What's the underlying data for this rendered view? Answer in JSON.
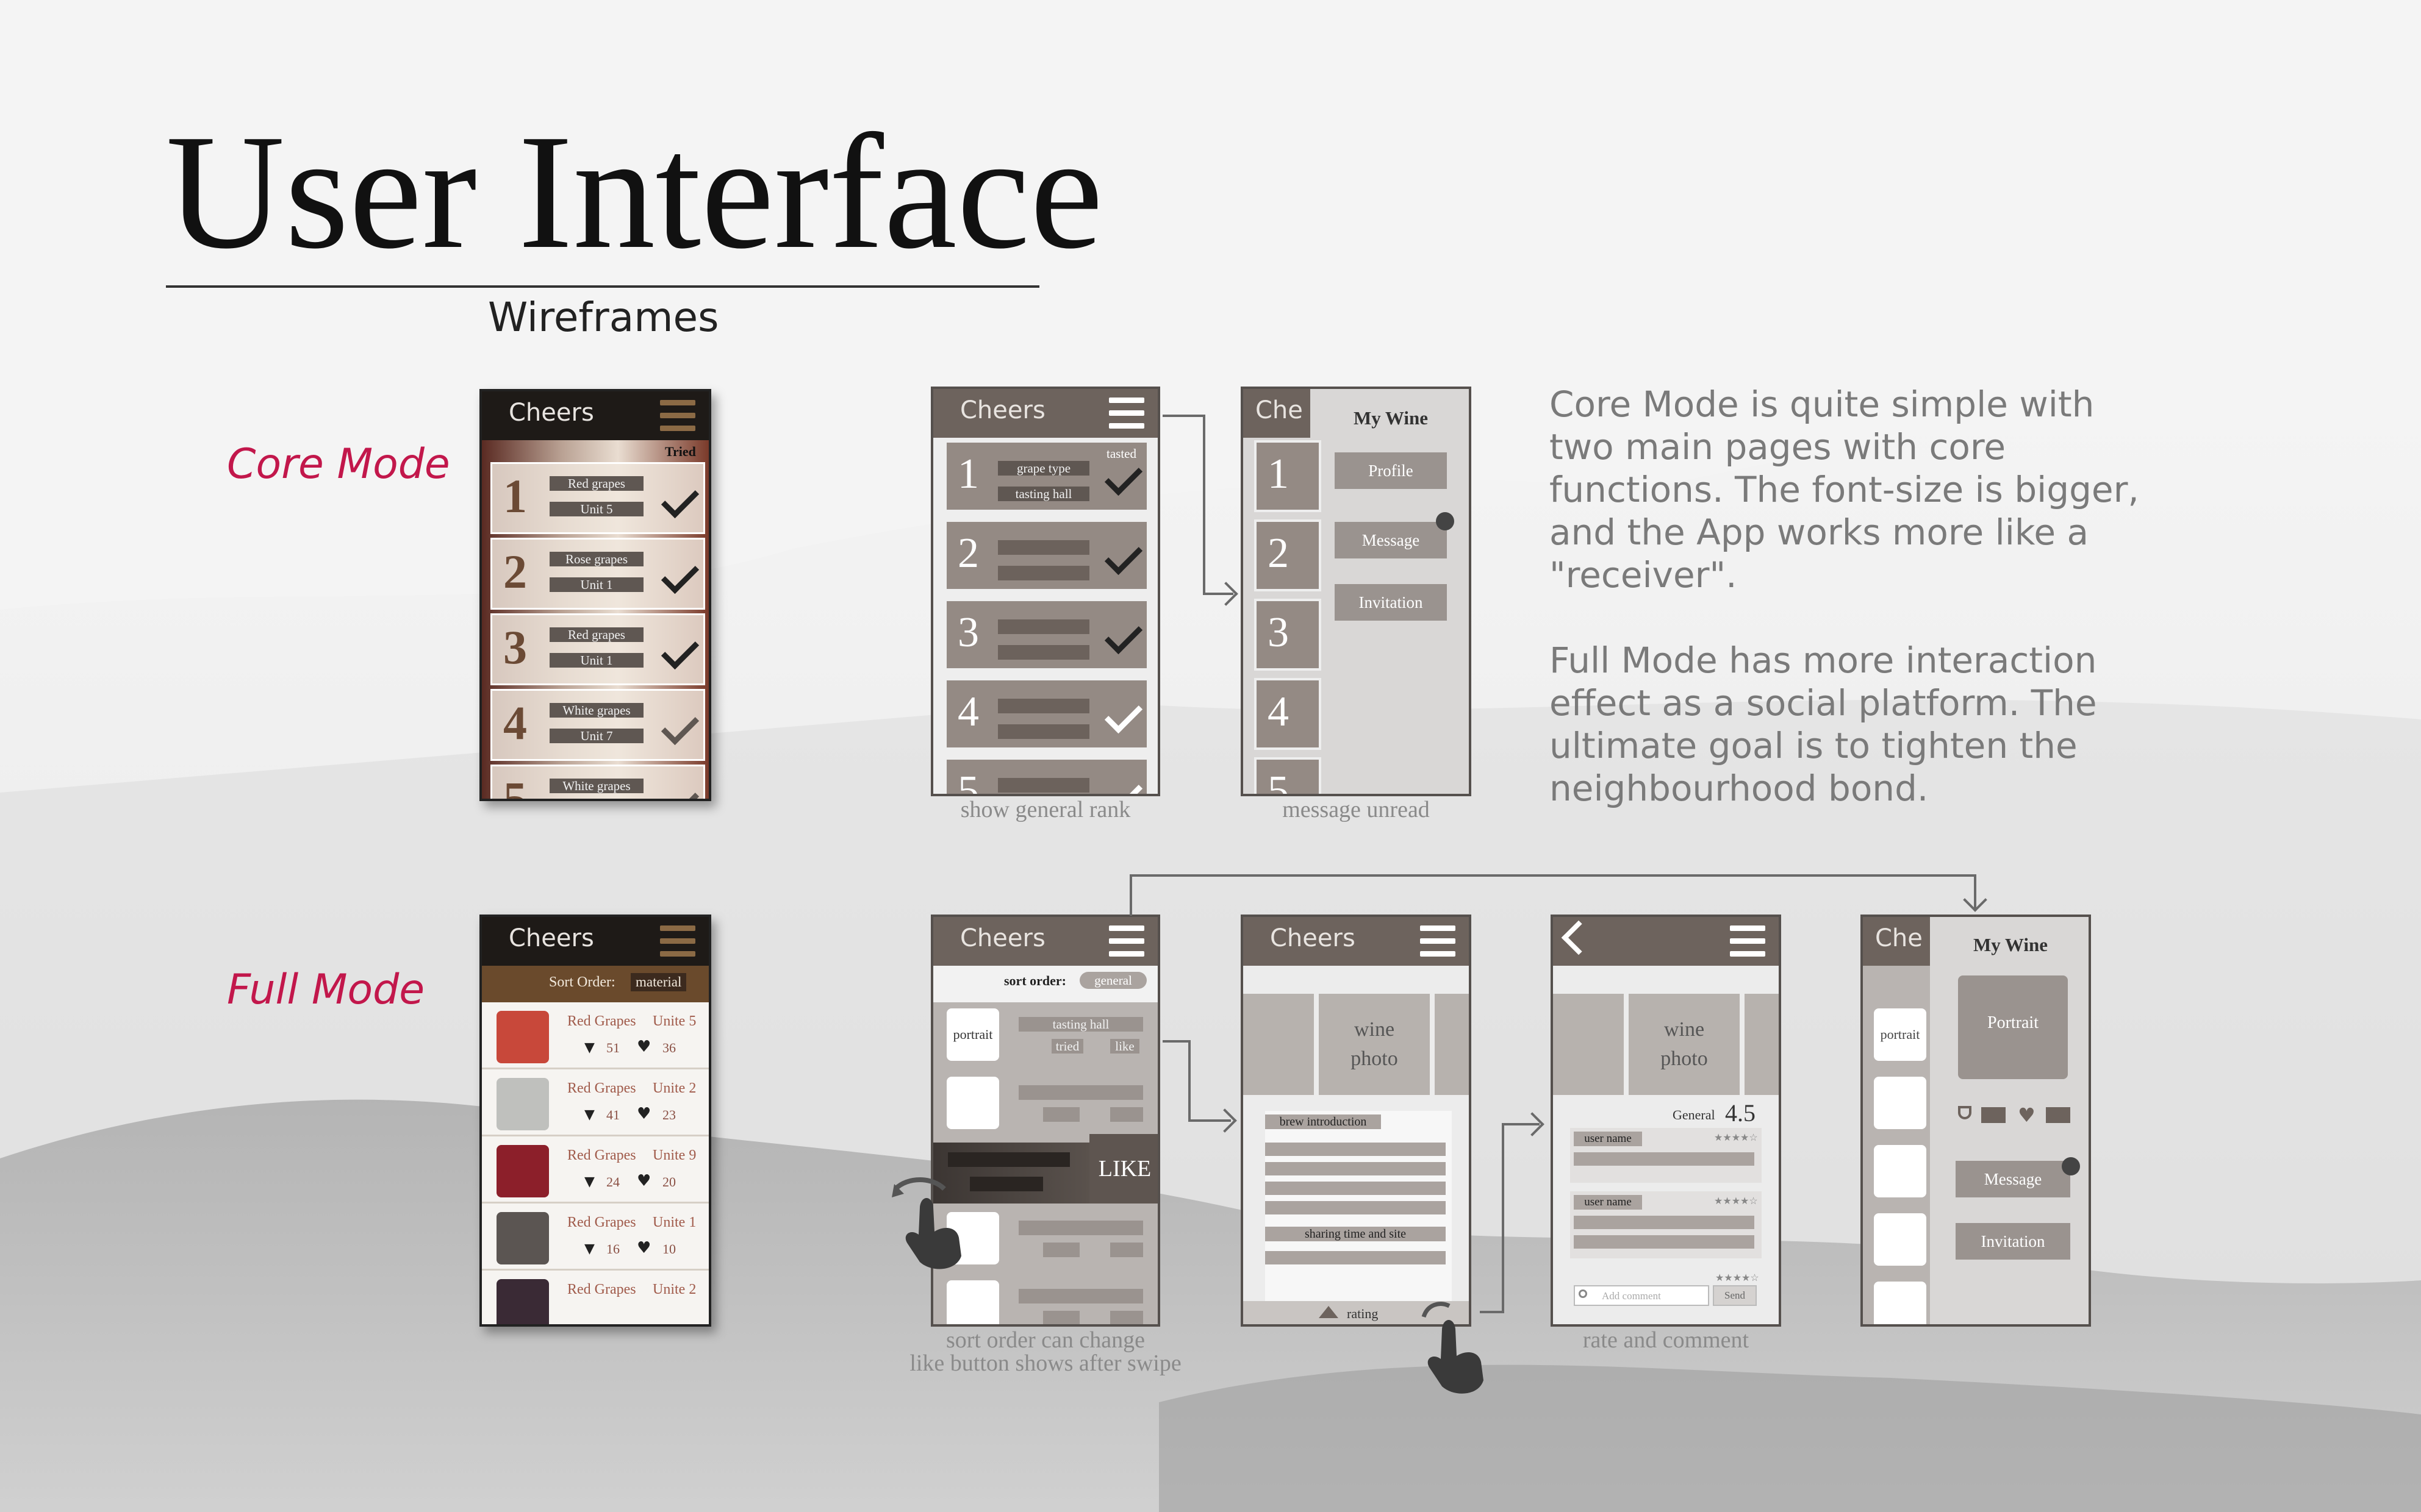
{
  "title": "User Interface",
  "subtitle": "Wireframes",
  "modes": {
    "core": "Core Mode",
    "full": "Full Mode"
  },
  "description": {
    "core_lines": [
      "Core Mode is quite simple with",
      "two main pages with core",
      "functions. The font-size is bigger,",
      "and the App works more like a",
      "\"receiver\"."
    ],
    "full_lines": [
      "Full Mode has more interaction",
      "effect as a social platform. The",
      "ultimate goal is to tighten the",
      "neighbourhood bond."
    ]
  },
  "app_name": "Cheers",
  "app_name_cut": "Che",
  "core_mock": {
    "tried_label": "Tried",
    "rows": [
      {
        "num": "1",
        "grape": "Red grapes",
        "unit": "Unit 5"
      },
      {
        "num": "2",
        "grape": "Rose grapes",
        "unit": "Unit 1"
      },
      {
        "num": "3",
        "grape": "Red grapes",
        "unit": "Unit 1"
      },
      {
        "num": "4",
        "grape": "White grapes",
        "unit": "Unit 7"
      },
      {
        "num": "5",
        "grape": "White grapes",
        "unit": ""
      }
    ]
  },
  "rank_wire": {
    "numbers": [
      "1",
      "2",
      "3",
      "4",
      "5"
    ],
    "grape_type": "grape type",
    "tasting_hall": "tasting hall",
    "tasted": "tasted",
    "caption": "show general rank"
  },
  "menu_wire": {
    "my_wine": "My Wine",
    "profile": "Profile",
    "message": "Message",
    "invitation": "Invitation",
    "caption": "message unread"
  },
  "full_mock": {
    "sort_label": "Sort Order:",
    "sort_value": "material",
    "items": [
      {
        "name": "Red Grapes",
        "unit": "Unite 5",
        "glasses": "51",
        "likes": "36",
        "color": "#c8483a"
      },
      {
        "name": "Red Grapes",
        "unit": "Unite 2",
        "glasses": "41",
        "likes": "23",
        "color": "#bfc0bd"
      },
      {
        "name": "Red Grapes",
        "unit": "Unite 9",
        "glasses": "24",
        "likes": "20",
        "color": "#8c1f2a"
      },
      {
        "name": "Red Grapes",
        "unit": "Unite 1",
        "glasses": "16",
        "likes": "10",
        "color": "#5b5552"
      },
      {
        "name": "Red Grapes",
        "unit": "Unite 2",
        "glasses": "",
        "likes": "",
        "color": "#3a2a35"
      }
    ]
  },
  "sort_wire": {
    "sort_label": "sort order:",
    "sort_value": "general",
    "portrait": "portrait",
    "tasting_hall": "tasting hall",
    "tried": "tried",
    "like": "like",
    "like_button": "LIKE",
    "caption_line1": "sort order can change",
    "caption_line2": "like button shows after swipe"
  },
  "detail_wire": {
    "wine_photo_line1": "wine",
    "wine_photo_line2": "photo",
    "brew": "brew introduction",
    "sharing": "sharing time and site",
    "rating": "rating"
  },
  "comment_wire": {
    "general": "General",
    "score": "4.5",
    "user_name": "user name",
    "stars": "★★★★☆",
    "add_comment": "Add comment",
    "send": "Send",
    "caption": "rate and comment"
  },
  "profile_wire": {
    "my_wine": "My Wine",
    "portrait_small": "portrait",
    "portrait": "Portrait",
    "message": "Message",
    "invitation": "Invitation"
  },
  "colors": {
    "accent": "#c2174b",
    "bar": "#6d635d",
    "row": "#948a84"
  }
}
